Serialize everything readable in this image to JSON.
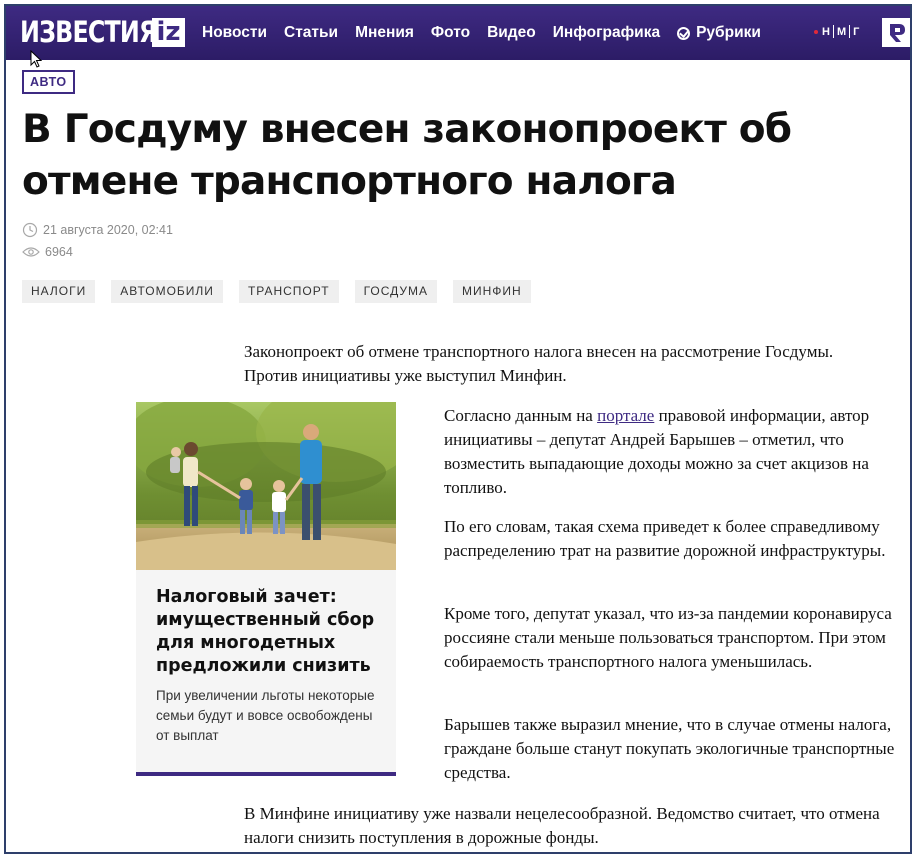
{
  "brand": {
    "logo_text": "ИЗВЕСТИЯ",
    "logo_badge": "iz",
    "primary_color": "#3e2a82"
  },
  "nav": {
    "items": [
      "Новости",
      "Статьи",
      "Мнения",
      "Фото",
      "Видео",
      "Инфографика"
    ],
    "rubrics_label": "Рубрики"
  },
  "partners": {
    "letters": [
      "Н",
      "М",
      "Г"
    ]
  },
  "article": {
    "category": "АВТО",
    "title": "В Госдуму внесен законопроект об отмене транспортного налога",
    "date": "21 августа 2020, 02:41",
    "views": "6964",
    "tags": [
      "НАЛОГИ",
      "АВТОМОБИЛИ",
      "ТРАНСПОРТ",
      "ГОСДУМА",
      "МИНФИН"
    ],
    "lead": "Законопроект об отмене транспортного налога внесен на рассмотрение Госдумы. Против инициативы уже выступил Минфин.",
    "p1_before": "Согласно данным на ",
    "p1_link": "портале",
    "p1_after": " правовой информации, автор инициативы – депутат Андрей Барышев – отметил, что возместить выпадающие доходы можно за счет акцизов на топливо.",
    "p2": "По его словам, такая схема приведет к более справедливому распределению трат на развитие дорожной инфраструктуры.",
    "p3": "Кроме того, депутат указал, что из-за пандемии коронавируса россияне стали меньше пользоваться транспортом. При этом собираемость транспортного налога уменьшилась.",
    "p4": "Барышев также выразил мнение, что в случае отмены налога, граждане больше станут покупать экологичные транспортные средства.",
    "p5": "В Минфине инициативу уже назвали нецелесообразной. Ведомство считает, что отмена налоги снизить поступления в дорожные фонды."
  },
  "related": {
    "title": "Налоговый зачет: имущественный сбор для многодетных предложили снизить",
    "subtitle": "При увеличении льготы некоторые семьи будут и вовсе освобождены от выплат"
  }
}
